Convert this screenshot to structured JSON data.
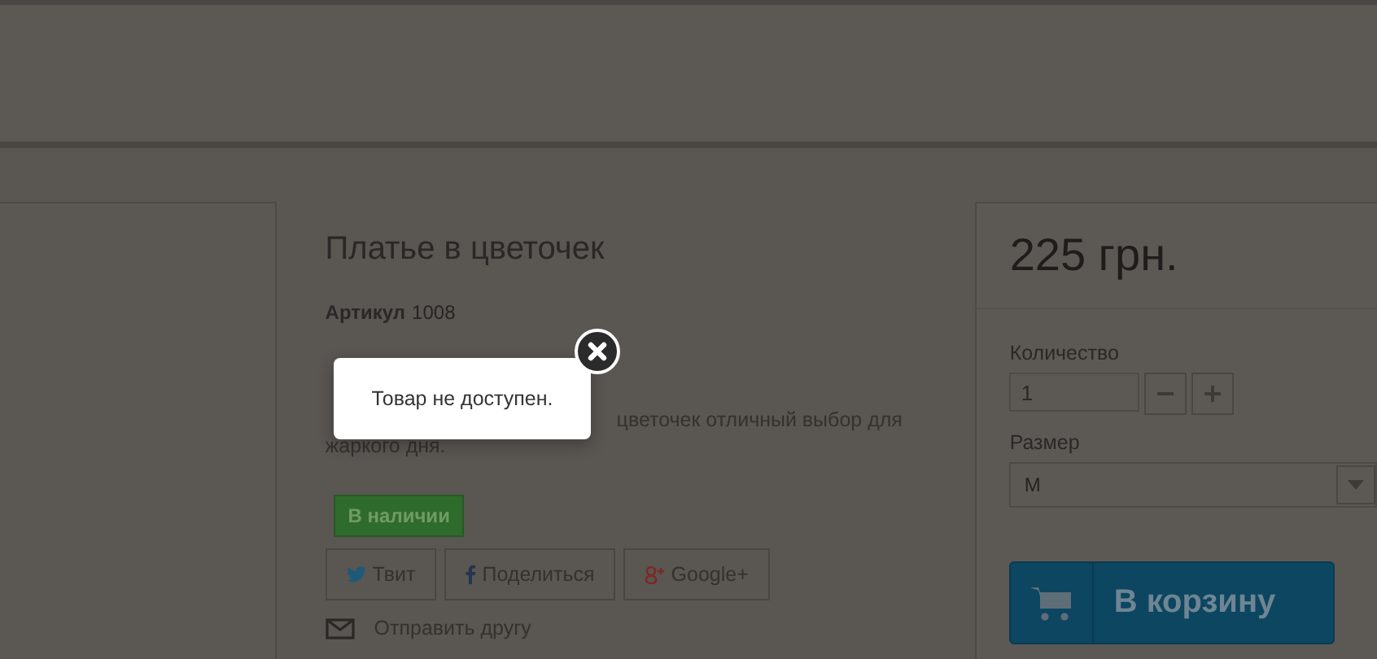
{
  "product": {
    "title": "Платье в цветочек",
    "sku_label": "Артикул",
    "sku": "1008",
    "description": [
      "цветочек отличный выбор для",
      "жаркого дня."
    ],
    "stock_badge": "В наличии",
    "share_buttons": [
      {
        "kind": "twitter",
        "label": "Твит"
      },
      {
        "kind": "facebook",
        "label": "Поделиться"
      },
      {
        "kind": "google",
        "label": "Google+"
      }
    ],
    "send_link": "Отправить другу"
  },
  "purchase": {
    "price": "225 грн.",
    "quantity_label": "Количество",
    "quantity": "1",
    "size_label": "Размер",
    "size": "M",
    "cart_button": "В корзину"
  },
  "popup": {
    "message": "Товар не доступен."
  }
}
